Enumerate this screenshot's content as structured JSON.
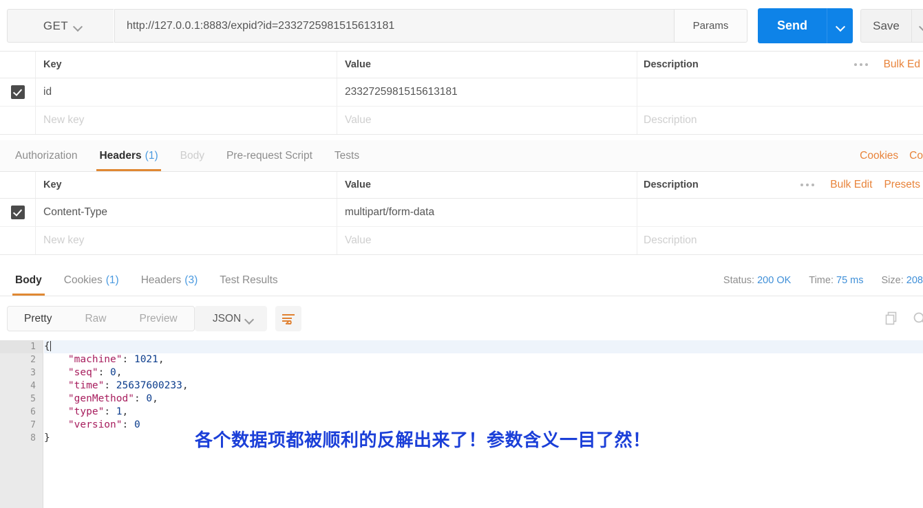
{
  "request_bar": {
    "method": "GET",
    "method_caret_icon": "chevron-down-icon",
    "url": "http://127.0.0.1:8883/expid?id=2332725981515613181",
    "params_label": "Params",
    "send_label": "Send",
    "send_caret_icon": "chevron-down-icon",
    "save_label": "Save",
    "save_caret_icon": "chevron-down-icon",
    "send_color": "#0e83e8"
  },
  "params_table": {
    "headers": {
      "key": "Key",
      "value": "Value",
      "description": "Description"
    },
    "more_icon": "ellipsis-icon",
    "actions": [
      "Bulk Ed"
    ],
    "rows": [
      {
        "checked": true,
        "key": "id",
        "value": "2332725981515613181",
        "description": ""
      }
    ],
    "new_row": {
      "key": "New key",
      "value": "Value",
      "description": "Description"
    }
  },
  "request_tabs": {
    "tabs": [
      {
        "label": "Authorization",
        "count": "",
        "active": false,
        "dim": false
      },
      {
        "label": "Headers",
        "count": "(1)",
        "active": true,
        "dim": false
      },
      {
        "label": "Body",
        "count": "",
        "active": false,
        "dim": true
      },
      {
        "label": "Pre-request Script",
        "count": "",
        "active": false,
        "dim": false
      },
      {
        "label": "Tests",
        "count": "",
        "active": false,
        "dim": false
      }
    ],
    "right_links": [
      "Cookies",
      "Co"
    ],
    "accent_color": "#e08833"
  },
  "headers_table": {
    "headers": {
      "key": "Key",
      "value": "Value",
      "description": "Description"
    },
    "more_icon": "ellipsis-icon",
    "actions": [
      "Bulk Edit",
      "Presets"
    ],
    "rows": [
      {
        "checked": true,
        "key": "Content-Type",
        "value": "multipart/form-data",
        "description": ""
      }
    ],
    "new_row": {
      "key": "New key",
      "value": "Value",
      "description": "Description"
    }
  },
  "response_tabs": {
    "tabs": [
      {
        "label": "Body",
        "count": "",
        "active": true
      },
      {
        "label": "Cookies",
        "count": "(1)",
        "active": false
      },
      {
        "label": "Headers",
        "count": "(3)",
        "active": false
      },
      {
        "label": "Test Results",
        "count": "",
        "active": false
      }
    ],
    "meta": [
      {
        "label": "Status:",
        "value": "200 OK"
      },
      {
        "label": "Time:",
        "value": "75 ms"
      },
      {
        "label": "Size:",
        "value": "208 "
      }
    ],
    "meta_value_color": "#3f8fd8"
  },
  "body_toolbar": {
    "view_modes": [
      {
        "label": "Pretty",
        "active": true
      },
      {
        "label": "Raw",
        "active": false
      },
      {
        "label": "Preview",
        "active": false
      }
    ],
    "format": "JSON",
    "format_caret_icon": "chevron-down-icon",
    "wrap_icon": "word-wrap-icon",
    "copy_icon": "copy-icon",
    "search_icon": "search-icon"
  },
  "response_body": {
    "language": "json",
    "lines": [
      {
        "no": "1",
        "folded": true,
        "current": true,
        "tokens": [
          {
            "t": "{",
            "c": "p"
          }
        ],
        "caret": true
      },
      {
        "no": "2",
        "folded": false,
        "current": false,
        "tokens": [
          {
            "t": "    \"machine\"",
            "c": "k"
          },
          {
            "t": ": ",
            "c": "p"
          },
          {
            "t": "1021",
            "c": "n"
          },
          {
            "t": ",",
            "c": "p"
          }
        ]
      },
      {
        "no": "3",
        "folded": false,
        "current": false,
        "tokens": [
          {
            "t": "    \"seq\"",
            "c": "k"
          },
          {
            "t": ": ",
            "c": "p"
          },
          {
            "t": "0",
            "c": "n"
          },
          {
            "t": ",",
            "c": "p"
          }
        ]
      },
      {
        "no": "4",
        "folded": false,
        "current": false,
        "tokens": [
          {
            "t": "    \"time\"",
            "c": "k"
          },
          {
            "t": ": ",
            "c": "p"
          },
          {
            "t": "25637600233",
            "c": "n"
          },
          {
            "t": ",",
            "c": "p"
          }
        ]
      },
      {
        "no": "5",
        "folded": false,
        "current": false,
        "tokens": [
          {
            "t": "    \"genMethod\"",
            "c": "k"
          },
          {
            "t": ": ",
            "c": "p"
          },
          {
            "t": "0",
            "c": "n"
          },
          {
            "t": ",",
            "c": "p"
          }
        ]
      },
      {
        "no": "6",
        "folded": false,
        "current": false,
        "tokens": [
          {
            "t": "    \"type\"",
            "c": "k"
          },
          {
            "t": ": ",
            "c": "p"
          },
          {
            "t": "1",
            "c": "n"
          },
          {
            "t": ",",
            "c": "p"
          }
        ]
      },
      {
        "no": "7",
        "folded": false,
        "current": false,
        "tokens": [
          {
            "t": "    \"version\"",
            "c": "k"
          },
          {
            "t": ": ",
            "c": "p"
          },
          {
            "t": "0",
            "c": "n"
          }
        ]
      },
      {
        "no": "8",
        "folded": false,
        "current": false,
        "tokens": [
          {
            "t": "}",
            "c": "p"
          }
        ]
      }
    ]
  },
  "annotation": {
    "text": "各个数据项都被顺利的反解出来了！参数含义一目了然！",
    "color": "#1b3fd8"
  }
}
